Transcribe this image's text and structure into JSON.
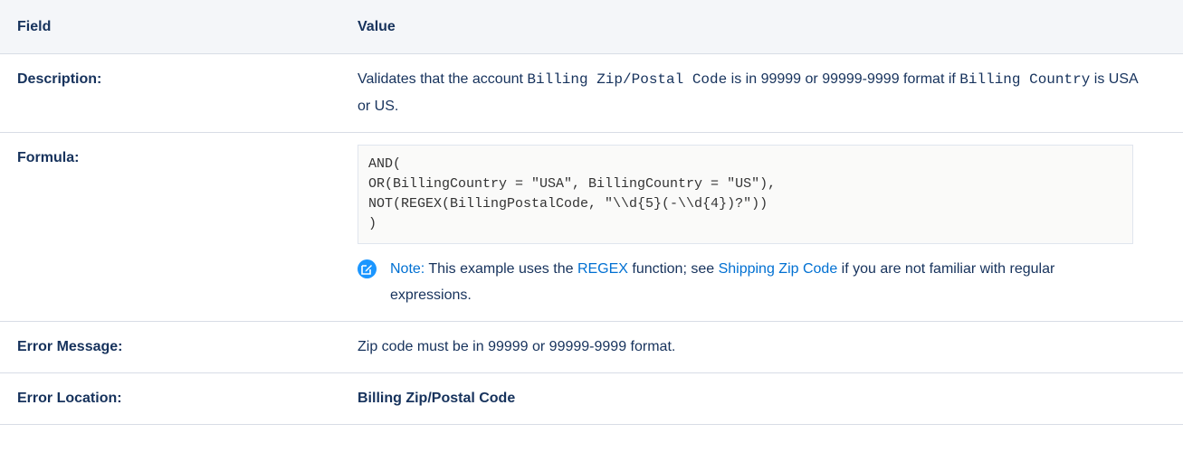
{
  "header": {
    "field": "Field",
    "value": "Value"
  },
  "rows": {
    "description": {
      "label": "Description:",
      "t1": "Validates that the account ",
      "code1": "Billing Zip/Postal Code",
      "t2": " is in 99999 or 99999-9999 format if ",
      "code2": "Billing Country",
      "t3": " is USA or US."
    },
    "formula": {
      "label": "Formula:",
      "code": "AND(\nOR(BillingCountry = \"USA\", BillingCountry = \"US\"),\nNOT(REGEX(BillingPostalCode, \"\\\\d{5}(-\\\\d{4})?\"))\n)",
      "note_label": "Note:",
      "note_t1": " This example uses the ",
      "note_link1": "REGEX",
      "note_t2": " function; see ",
      "note_link2": "Shipping Zip Code",
      "note_t3": " if you are not familiar with regular expressions."
    },
    "error_message": {
      "label": "Error Message:",
      "value": "Zip code must be in 99999 or 99999-9999 format."
    },
    "error_location": {
      "label": "Error Location:",
      "value": "Billing Zip/Postal Code"
    }
  },
  "icons": {
    "note": "note-edit-icon"
  },
  "colors": {
    "link": "#0070d2",
    "note_icon": "#1b96ff",
    "header_bg": "#f4f6f9",
    "text": "#16325c"
  }
}
